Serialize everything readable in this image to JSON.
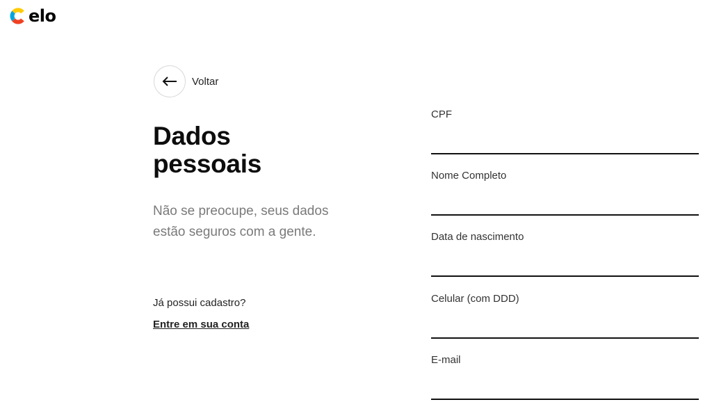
{
  "brand": {
    "logo_text": "elo",
    "logo_colors": [
      "#00a4e0",
      "#ef4123",
      "#ffcb05"
    ]
  },
  "back": {
    "label": "Voltar",
    "icon": "arrow-left-icon"
  },
  "main": {
    "title_line1": "Dados",
    "title_line2": "pessoais",
    "subtitle": "Não se preocupe, seus dados estão seguros com a gente.",
    "has_account": "Já possui cadastro?",
    "login_link": "Entre em sua conta"
  },
  "form": {
    "fields": [
      {
        "label": "CPF",
        "value": ""
      },
      {
        "label": "Nome Completo",
        "value": ""
      },
      {
        "label": "Data de nascimento",
        "value": ""
      },
      {
        "label": "Celular (com DDD)",
        "value": ""
      },
      {
        "label": "E-mail",
        "value": ""
      }
    ]
  }
}
